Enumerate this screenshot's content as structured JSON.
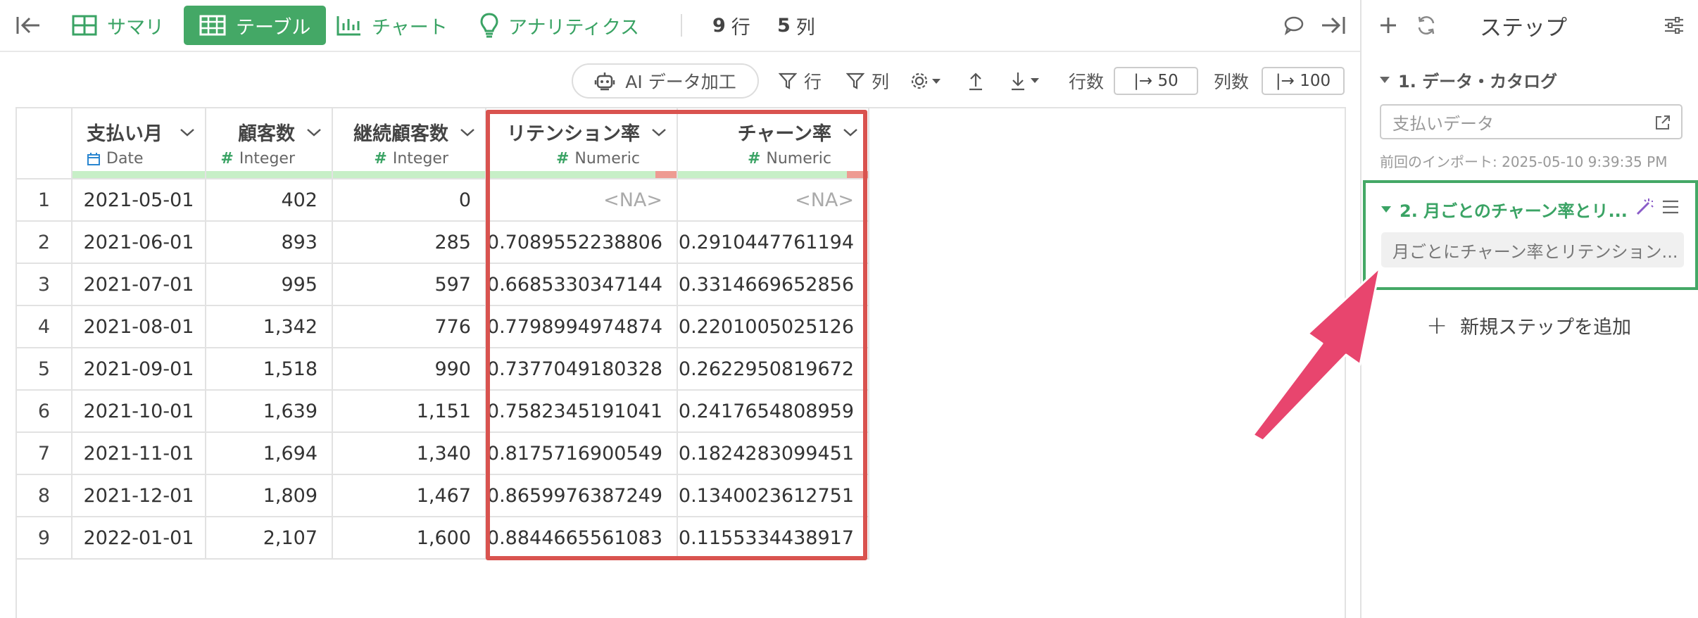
{
  "toolbar": {
    "tabs": [
      {
        "label": "サマリ",
        "icon": "summary-icon",
        "active": false
      },
      {
        "label": "テーブル",
        "icon": "table-icon",
        "active": true
      },
      {
        "label": "チャート",
        "icon": "chart-icon",
        "active": false
      },
      {
        "label": "アナリティクス",
        "icon": "bulb-icon",
        "active": false
      }
    ],
    "rows_count": "9",
    "rows_label": "行",
    "cols_count": "5",
    "cols_label": "列"
  },
  "subtoolbar": {
    "ai_label": "AI データ加工",
    "row_filter_label": "行",
    "col_filter_label": "列",
    "rows_label": "行数",
    "rows_value": "|→ 50",
    "cols_label": "列数",
    "cols_value": "|→ 100"
  },
  "table": {
    "columns": [
      {
        "name": "支払い月",
        "type": "Date"
      },
      {
        "name": "顧客数",
        "type": "Integer"
      },
      {
        "name": "継続顧客数",
        "type": "Integer"
      },
      {
        "name": "リテンション率",
        "type": "Numeric"
      },
      {
        "name": "チャーン率",
        "type": "Numeric"
      }
    ],
    "rows": [
      [
        "1",
        "2021-05-01",
        "402",
        "0",
        "<NA>",
        "<NA>"
      ],
      [
        "2",
        "2021-06-01",
        "893",
        "285",
        "0.7089552238806",
        "0.2910447761194"
      ],
      [
        "3",
        "2021-07-01",
        "995",
        "597",
        "0.6685330347144",
        "0.3314669652856"
      ],
      [
        "4",
        "2021-08-01",
        "1,342",
        "776",
        "0.7798994974874",
        "0.2201005025126"
      ],
      [
        "5",
        "2021-09-01",
        "1,518",
        "990",
        "0.7377049180328",
        "0.2622950819672"
      ],
      [
        "6",
        "2021-10-01",
        "1,639",
        "1,151",
        "0.7582345191041",
        "0.2417654808959"
      ],
      [
        "7",
        "2021-11-01",
        "1,694",
        "1,340",
        "0.8175716900549",
        "0.1824283099451"
      ],
      [
        "8",
        "2021-12-01",
        "1,809",
        "1,467",
        "0.8659976387249",
        "0.1340023612751"
      ],
      [
        "9",
        "2022-01-01",
        "2,107",
        "1,600",
        "0.8844665561083",
        "0.1155334438917"
      ]
    ]
  },
  "steps_panel": {
    "title": "ステップ",
    "step1": {
      "title": "1. データ・カタログ",
      "input": "支払いデータ",
      "import_note": "前回のインポート: 2025-05-10 9:39:35 PM"
    },
    "step2": {
      "title": "2. 月ごとのチャーン率とリ...",
      "desc": "月ごとにチャーン率とリテンション..."
    },
    "add_step": "新規ステップを追加"
  },
  "colors": {
    "brand_green": "#44a866",
    "highlight_red": "#d9534f",
    "arrow_pink": "#e8456e"
  }
}
